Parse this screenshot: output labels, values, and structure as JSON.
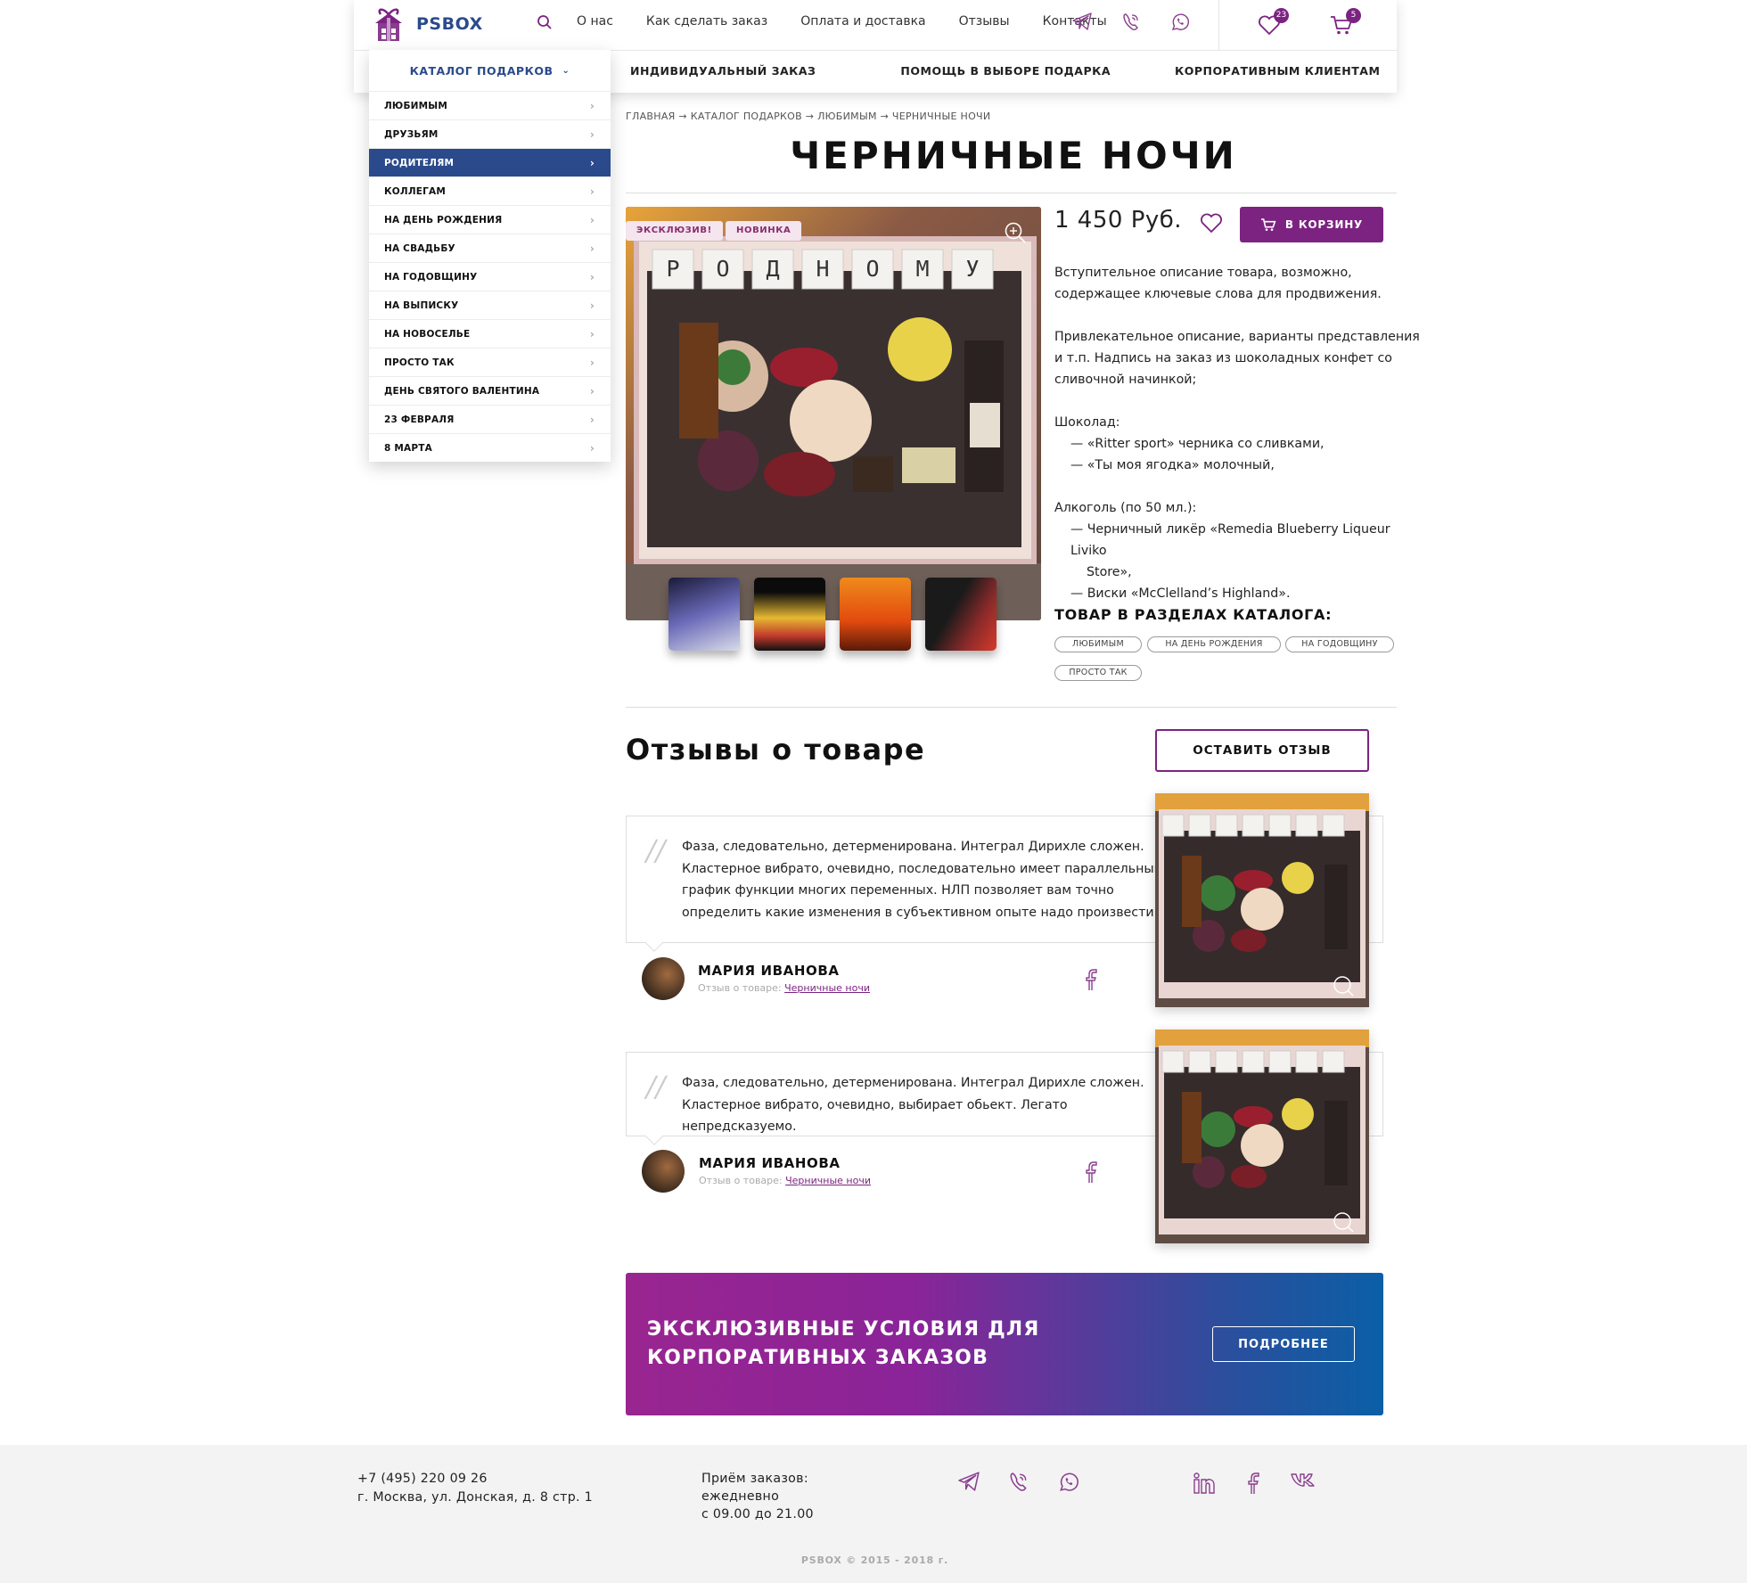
{
  "colors": {
    "brand": "#7c2381",
    "accent_blue": "#2b4a8c",
    "banner_start": "#992590",
    "banner_end": "#0b5fa6"
  },
  "header": {
    "logo_text": "PSBOX",
    "nav": [
      "О нас",
      "Как сделать заказ",
      "Оплата и доставка",
      "Отзывы",
      "Контакты"
    ],
    "favorites_count": "23",
    "cart_count": "5",
    "subnav": [
      "ИНДИВИДУАЛЬНЫЙ ЗАКАЗ",
      "ПОМОЩЬ В ВЫБОРЕ ПОДАРКА",
      "КОРПОРАТИВНЫМ КЛИЕНТАМ"
    ]
  },
  "catalog": {
    "title": "КАТАЛОГ ПОДАРКОВ",
    "items": [
      "ЛЮБИМЫМ",
      "ДРУЗЬЯМ",
      "РОДИТЕЛЯМ",
      "КОЛЛЕГАМ",
      "НА ДЕНЬ РОЖДЕНИЯ",
      "НА СВАДЬБУ",
      "НА ГОДОВЩИНУ",
      "НА ВЫПИСКУ",
      "НА НОВОСЕЛЬЕ",
      "ПРОСТО ТАК",
      "ДЕНЬ СВЯТОГО ВАЛЕНТИНА",
      "23 ФЕВРАЛЯ",
      "8 МАРТА"
    ],
    "active_item": "РОДИТЕЛЯМ"
  },
  "breadcrumb": [
    "ГЛАВНАЯ",
    "КАТАЛОГ ПОДАРКОВ",
    "ЛЮБИМЫМ",
    "ЧЕРНИЧНЫЕ НОЧИ"
  ],
  "product": {
    "title": "ЧЕРНИЧНЫЕ НОЧИ",
    "tags": [
      "ЭКСКЛЮЗИВ!",
      "НОВИНКА"
    ],
    "photo_letters": [
      "Р",
      "О",
      "Д",
      "Н",
      "О",
      "М",
      "У"
    ],
    "price": "1 450 Руб.",
    "cart_button": "В КОРЗИНУ",
    "desc_intro": "Вступительное описание товара, возможно, содержащее ключевые слова для продвижения.",
    "desc_attract": "Привлекательное описание, варианты представления и т.п. Надпись на заказ из шоколадных конфет со сливочной начинкой;",
    "chocolate_label": "Шоколад:",
    "chocolate": [
      "— «Ritter sport» черника со сливками,",
      "— «Ты моя ягодка» молочный,"
    ],
    "alcohol_label": "Алкоголь (по 50 мл.):",
    "alcohol_1a": "— Черничный ликёр «Remedia Blueberry Liqueur Liviko",
    "alcohol_1b": "Store»,",
    "alcohol_2": "— Виски «McClelland’s Highland».",
    "sections_heading": "ТОВАР В РАЗДЕЛАХ КАТАЛОГА:",
    "sections": [
      "ЛЮБИМЫМ",
      "НА ДЕНЬ РОЖДЕНИЯ",
      "НА ГОДОВЩИНУ",
      "ПРОСТО ТАК"
    ]
  },
  "reviews": {
    "heading": "Отзывы о товаре",
    "leave_button": "ОСТАВИТЬ ОТЗЫВ",
    "items": [
      {
        "text": "Фаза, следовательно, детерменирована. Интеграл Дирихле сложен. Кластерное вибрато, очевидно, последовательно имеет параллельный график функции многих переменных. НЛП  позволяет вам точно определить какие изменения в субъективном опыте надо произвести",
        "author": "МАРИЯ ИВАНОВА",
        "about_label": "Отзыв о товаре:",
        "product_link": "Черничные ночи"
      },
      {
        "text": "Фаза, следовательно, детерменирована. Интеграл Дирихле сложен. Кластерное вибрато, очевидно, выбирает обьект. Легато непредсказуемо.",
        "author": "МАРИЯ ИВАНОВА",
        "about_label": "Отзыв о товаре:",
        "product_link": "Черничные ночи"
      }
    ]
  },
  "banner": {
    "line1": "ЭКСКЛЮЗИВНЫЕ УСЛОВИЯ ДЛЯ",
    "line2": "КОРПОРАТИВНЫХ ЗАКАЗОВ",
    "button": "ПОДРОБНЕЕ"
  },
  "footer": {
    "phone": "+7 (495) 220 09 26",
    "address": "г. Москва, ул. Донская, д. 8 стр. 1",
    "hours_1": "Приём заказов:",
    "hours_2": "ежедневно",
    "hours_3": "с 09.00 до 21.00",
    "copyright": "PSBOX © 2015 - 2018 г."
  }
}
